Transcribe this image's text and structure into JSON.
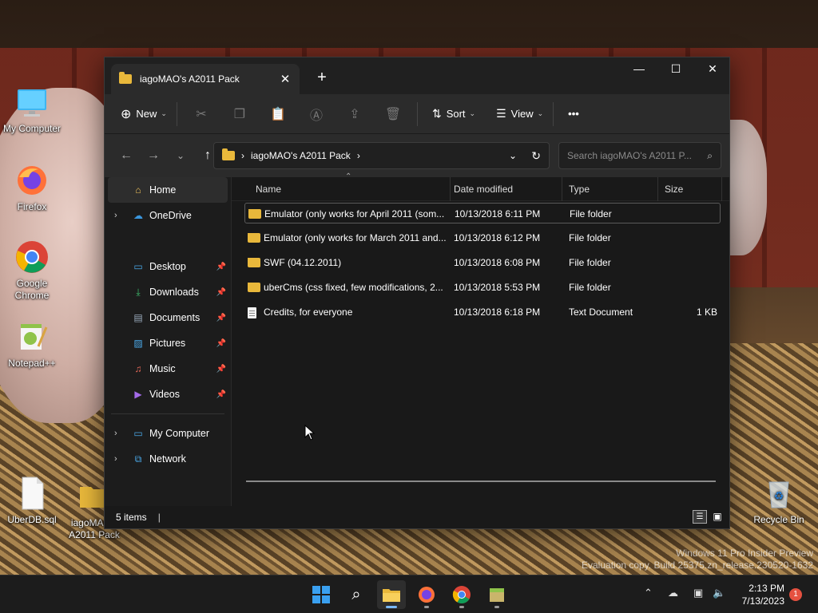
{
  "desktop": {
    "icons": [
      {
        "label": "My Computer"
      },
      {
        "label": "Firefox"
      },
      {
        "label": "Google Chrome"
      },
      {
        "label": "Notepad++"
      },
      {
        "label": "UberDB.sql"
      },
      {
        "label": "iagoMAO's A2011 Pack"
      },
      {
        "label": "Recycle Bin"
      }
    ],
    "watermark_line1": "Windows 11 Pro Insider Preview",
    "watermark_line2": "Evaluation copy. Build 25375.zn_release.230520-1632"
  },
  "window": {
    "tab_title": "iagoMAO's A2011 Pack",
    "new_tab": "+",
    "controls": {
      "minimize": "—",
      "maximize": "☐",
      "close": "✕"
    }
  },
  "toolbar": {
    "new_label": "New",
    "sort_label": "Sort",
    "view_label": "View",
    "more_label": "•••"
  },
  "address": {
    "segment": "iagoMAO's A2011 Pack",
    "search_placeholder": "Search iagoMAO's A2011 P..."
  },
  "nav": {
    "home": "Home",
    "onedrive": "OneDrive",
    "desktop": "Desktop",
    "downloads": "Downloads",
    "documents": "Documents",
    "pictures": "Pictures",
    "music": "Music",
    "videos": "Videos",
    "my_computer": "My Computer",
    "network": "Network"
  },
  "columns": {
    "name": "Name",
    "date": "Date modified",
    "type": "Type",
    "size": "Size"
  },
  "files": [
    {
      "name": "Emulator (only works for April 2011 (som...",
      "date": "10/13/2018 6:11 PM",
      "type": "File folder",
      "size": "",
      "kind": "folder"
    },
    {
      "name": "Emulator (only works for March 2011 and...",
      "date": "10/13/2018 6:12 PM",
      "type": "File folder",
      "size": "",
      "kind": "folder"
    },
    {
      "name": "SWF (04.12.2011)",
      "date": "10/13/2018 6:08 PM",
      "type": "File folder",
      "size": "",
      "kind": "folder"
    },
    {
      "name": "uberCms (css fixed, few modifications, 2...",
      "date": "10/13/2018 5:53 PM",
      "type": "File folder",
      "size": "",
      "kind": "folder"
    },
    {
      "name": "Credits, for everyone",
      "date": "10/13/2018 6:18 PM",
      "type": "Text Document",
      "size": "1 KB",
      "kind": "text"
    }
  ],
  "status": {
    "count": "5 items"
  },
  "taskbar": {
    "time": "2:13 PM",
    "date": "7/13/2023",
    "notifications": "1"
  }
}
